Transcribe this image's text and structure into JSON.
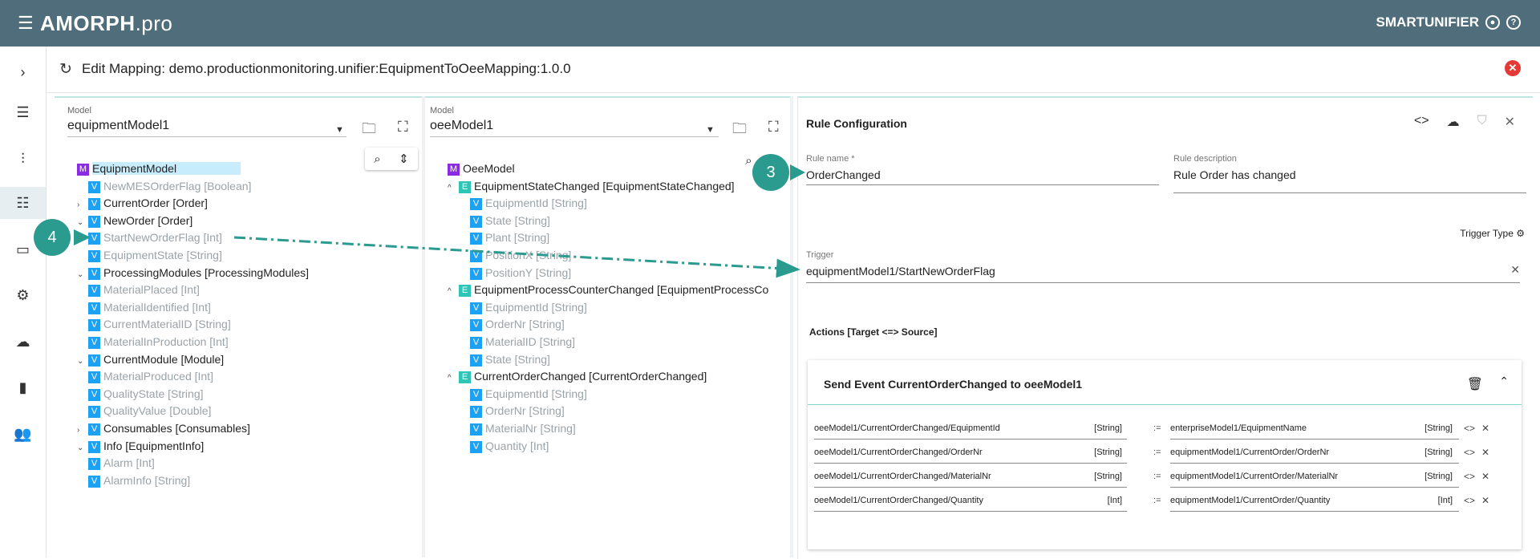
{
  "topbar": {
    "brand": "AMORPH",
    "brand_suffix": ".pro",
    "product": "SMARTUNIFIER"
  },
  "header": {
    "title": "Edit Mapping:  demo.productionmonitoring.unifier:EquipmentToOeeMapping:1.0.0"
  },
  "left_panel": {
    "label": "Model",
    "value": "equipmentModel1",
    "tree": [
      {
        "badge": "M",
        "text": "EquipmentModel",
        "level": 0,
        "chevron": "",
        "selected": true,
        "light": false
      },
      {
        "badge": "V",
        "text": "NewMESOrderFlag [Boolean]",
        "level": 1,
        "chevron": "",
        "light": true
      },
      {
        "badge": "V",
        "text": "CurrentOrder [Order]",
        "level": 1,
        "chevron": "›",
        "light": false
      },
      {
        "badge": "V",
        "text": "NewOrder [Order]",
        "level": 1,
        "chevron": "⌄",
        "light": false
      },
      {
        "badge": "V",
        "text": "StartNewOrderFlag [Int]",
        "level": 1,
        "chevron": "",
        "light": true
      },
      {
        "badge": "V",
        "text": "EquipmentState [String]",
        "level": 1,
        "chevron": "",
        "light": true
      },
      {
        "badge": "V",
        "text": "ProcessingModules [ProcessingModules]",
        "level": 1,
        "chevron": "⌄",
        "light": false
      },
      {
        "badge": "V",
        "text": "MaterialPlaced [Int]",
        "level": 1,
        "chevron": "",
        "light": true
      },
      {
        "badge": "V",
        "text": "MaterialIdentified [Int]",
        "level": 1,
        "chevron": "",
        "light": true
      },
      {
        "badge": "V",
        "text": "CurrentMaterialID [String]",
        "level": 1,
        "chevron": "",
        "light": true
      },
      {
        "badge": "V",
        "text": "MaterialInProduction [Int]",
        "level": 1,
        "chevron": "",
        "light": true
      },
      {
        "badge": "V",
        "text": "CurrentModule [Module]",
        "level": 1,
        "chevron": "⌄",
        "light": false
      },
      {
        "badge": "V",
        "text": "MaterialProduced [Int]",
        "level": 1,
        "chevron": "",
        "light": true
      },
      {
        "badge": "V",
        "text": "QualityState [String]",
        "level": 1,
        "chevron": "",
        "light": true
      },
      {
        "badge": "V",
        "text": "QualityValue [Double]",
        "level": 1,
        "chevron": "",
        "light": true
      },
      {
        "badge": "V",
        "text": "Consumables [Consumables]",
        "level": 1,
        "chevron": "›",
        "light": false
      },
      {
        "badge": "V",
        "text": "Info [EquipmentInfo]",
        "level": 1,
        "chevron": "⌄",
        "light": false
      },
      {
        "badge": "V",
        "text": "Alarm [Int]",
        "level": 1,
        "chevron": "",
        "light": true
      },
      {
        "badge": "V",
        "text": "AlarmInfo [String]",
        "level": 1,
        "chevron": "",
        "light": true
      }
    ]
  },
  "mid_panel": {
    "label": "Model",
    "value": "oeeModel1",
    "tree": [
      {
        "badge": "M",
        "text": "OeeModel",
        "level": 0,
        "chevron": "",
        "light": false
      },
      {
        "badge": "E",
        "text": "EquipmentStateChanged [EquipmentStateChanged]",
        "level": 1,
        "chevron": "^",
        "light": false
      },
      {
        "badge": "V",
        "text": "EquipmentId [String]",
        "level": 2,
        "chevron": "",
        "light": true
      },
      {
        "badge": "V",
        "text": "State [String]",
        "level": 2,
        "chevron": "",
        "light": true
      },
      {
        "badge": "V",
        "text": "Plant [String]",
        "level": 2,
        "chevron": "",
        "light": true
      },
      {
        "badge": "V",
        "text": "PositionX [String]",
        "level": 2,
        "chevron": "",
        "light": true
      },
      {
        "badge": "V",
        "text": "PositionY [String]",
        "level": 2,
        "chevron": "",
        "light": true
      },
      {
        "badge": "E",
        "text": "EquipmentProcessCounterChanged [EquipmentProcessCo",
        "level": 1,
        "chevron": "^",
        "light": false
      },
      {
        "badge": "V",
        "text": "EquipmentId [String]",
        "level": 2,
        "chevron": "",
        "light": true
      },
      {
        "badge": "V",
        "text": "OrderNr [String]",
        "level": 2,
        "chevron": "",
        "light": true
      },
      {
        "badge": "V",
        "text": "MaterialID [String]",
        "level": 2,
        "chevron": "",
        "light": true
      },
      {
        "badge": "V",
        "text": "State [String]",
        "level": 2,
        "chevron": "",
        "light": true
      },
      {
        "badge": "E",
        "text": "CurrentOrderChanged [CurrentOrderChanged]",
        "level": 1,
        "chevron": "^",
        "light": false
      },
      {
        "badge": "V",
        "text": "EquipmentId [String]",
        "level": 2,
        "chevron": "",
        "light": true
      },
      {
        "badge": "V",
        "text": "OrderNr [String]",
        "level": 2,
        "chevron": "",
        "light": true
      },
      {
        "badge": "V",
        "text": "MaterialNr [String]",
        "level": 2,
        "chevron": "",
        "light": true
      },
      {
        "badge": "V",
        "text": "Quantity [Int]",
        "level": 2,
        "chevron": "",
        "light": true
      }
    ]
  },
  "rule": {
    "heading": "Rule Configuration",
    "name_label": "Rule name *",
    "name_value": "OrderChanged",
    "desc_label": "Rule description",
    "desc_value": "Rule Order has changed",
    "trigger_type": "Trigger Type",
    "trigger_label": "Trigger",
    "trigger_value": "equipmentModel1/StartNewOrderFlag",
    "actions_title": "Actions [Target <=> Source]",
    "card_title": "Send Event CurrentOrderChanged to oeeModel1",
    "assign": ":=",
    "actions": [
      {
        "target": "oeeModel1/CurrentOrderChanged/EquipmentId",
        "ttype": "[String]",
        "source": "enterpriseModel1/EquipmentName",
        "stype": "[String]"
      },
      {
        "target": "oeeModel1/CurrentOrderChanged/OrderNr",
        "ttype": "[String]",
        "source": "equipmentModel1/CurrentOrder/OrderNr",
        "stype": "[String]"
      },
      {
        "target": "oeeModel1/CurrentOrderChanged/MaterialNr",
        "ttype": "[String]",
        "source": "equipmentModel1/CurrentOrder/MaterialNr",
        "stype": "[String]"
      },
      {
        "target": "oeeModel1/CurrentOrderChanged/Quantity",
        "ttype": "[Int]",
        "source": "equipmentModel1/CurrentOrder/Quantity",
        "stype": "[Int]"
      }
    ]
  },
  "steps": {
    "a": "3",
    "b": "4"
  },
  "colors": {
    "topbar": "#4f6d7a",
    "accent": "#2b9b8f",
    "model_badge": "#8a2be2",
    "var_badge": "#1da1f2",
    "event_badge": "#2ec4b6"
  }
}
